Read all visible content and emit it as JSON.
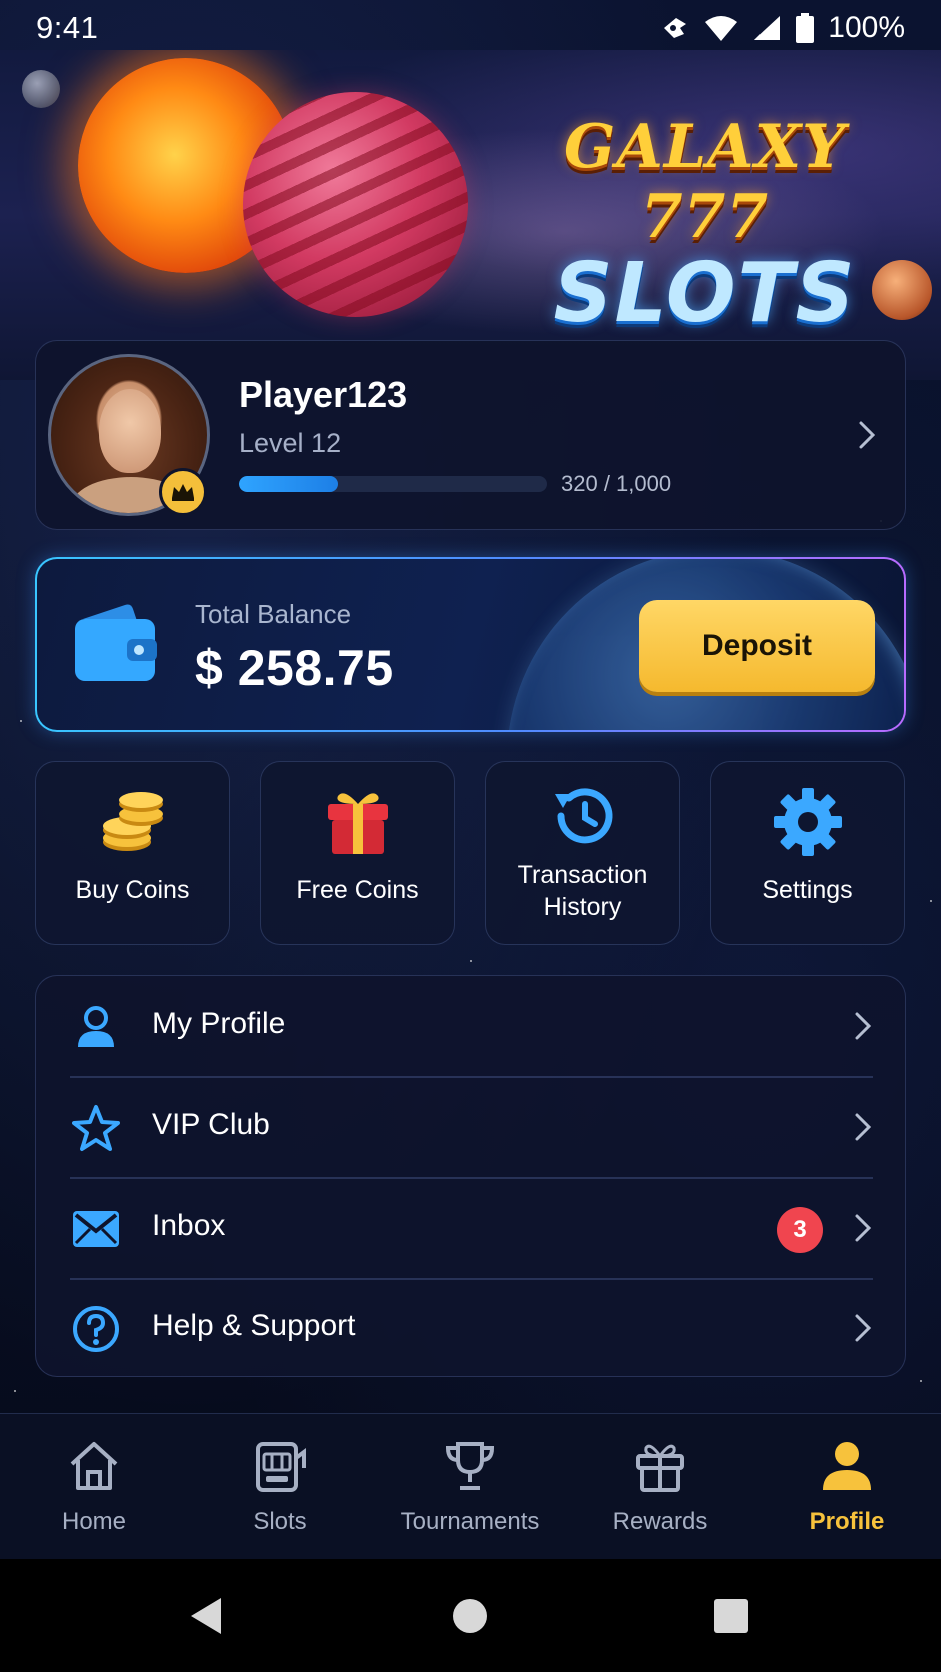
{
  "status_bar": {
    "time": "9:41",
    "battery": "100%",
    "icons": [
      "notification-icon",
      "wifi-icon",
      "cellular-signal-icon",
      "battery-icon"
    ]
  },
  "banner": {
    "logo_line1": "GALAXY 777",
    "logo_line2": "SLOTS"
  },
  "profile": {
    "name": "Player123",
    "level": "Level 12",
    "xp_text": "320 / 1,000",
    "xp_progress": 0.32
  },
  "balance": {
    "label": "Total Balance",
    "value": "$ 258.75",
    "deposit_label": "Deposit"
  },
  "quick_actions": [
    {
      "label": "Buy Coins",
      "icon": "coins-icon"
    },
    {
      "label": "Free Coins",
      "icon": "gift-icon"
    },
    {
      "label": "Transaction History",
      "label_line1": "Transaction",
      "label_line2": "History",
      "icon": "history-icon"
    },
    {
      "label": "Settings",
      "icon": "gear-icon"
    }
  ],
  "menu": [
    {
      "label": "My Profile",
      "icon": "user-icon"
    },
    {
      "label": "VIP Club",
      "icon": "star-icon"
    },
    {
      "label": "Inbox",
      "icon": "mail-icon",
      "badge": "3"
    },
    {
      "label": "Help & Support",
      "icon": "help-icon"
    }
  ],
  "bottom_nav": [
    {
      "label": "Home",
      "icon": "home-icon"
    },
    {
      "label": "Slots",
      "icon": "slot-machine-icon"
    },
    {
      "label": "Tournaments",
      "icon": "trophy-icon"
    },
    {
      "label": "Rewards",
      "icon": "gift-icon"
    },
    {
      "label": "Profile",
      "icon": "user-icon",
      "active": true
    }
  ],
  "colors": {
    "accent_blue": "#2fa4ff",
    "accent_gold": "#f7c23c",
    "badge_red": "#f0454f",
    "background": "#070b1a"
  }
}
